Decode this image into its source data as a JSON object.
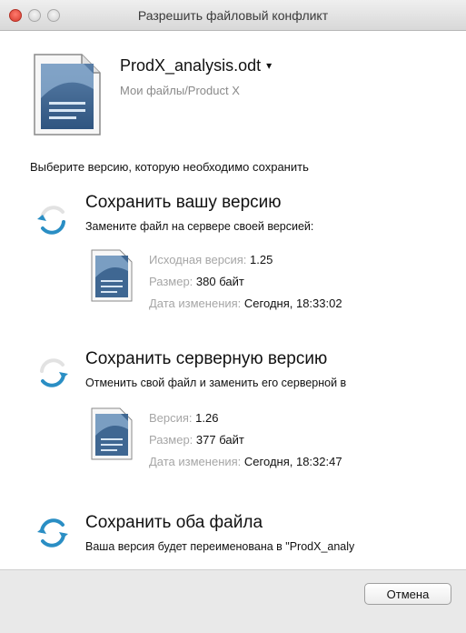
{
  "window": {
    "title": "Разрешить файловый конфликт"
  },
  "file": {
    "name": "ProdX_analysis.odt",
    "menu_indicator": "▾",
    "path": "Мои файлы/Product X"
  },
  "prompt": "Выберите версию, которую необходимо сохранить",
  "options": [
    {
      "title": "Сохранить вашу версию",
      "description": "Замените файл на сервере своей версией:",
      "details": [
        {
          "label": "Исходная версия:",
          "value": "1.25"
        },
        {
          "label": "Размер:",
          "value": "380 байт"
        },
        {
          "label": "Дата изменения:",
          "value": "Сегодня, 18:33:02"
        }
      ]
    },
    {
      "title": "Сохранить серверную версию",
      "description": "Отменить свой файл и заменить его серверной в",
      "details": [
        {
          "label": "Версия:",
          "value": "1.26"
        },
        {
          "label": "Размер:",
          "value": "377 байт"
        },
        {
          "label": "Дата изменения:",
          "value": "Сегодня, 18:32:47"
        }
      ]
    },
    {
      "title": "Сохранить оба файла",
      "description": "Ваша версия будет переименована в \"ProdX_analy"
    }
  ],
  "buttons": {
    "cancel": "Отмена"
  },
  "icons": {
    "document": "document-icon",
    "sync_active": "sync-icon-blue",
    "sync_inactive": "sync-icon-gray"
  },
  "colors": {
    "accent_blue": "#2a8ec4",
    "muted_label": "#a6a6a6",
    "close_button": "#d63a2d"
  }
}
